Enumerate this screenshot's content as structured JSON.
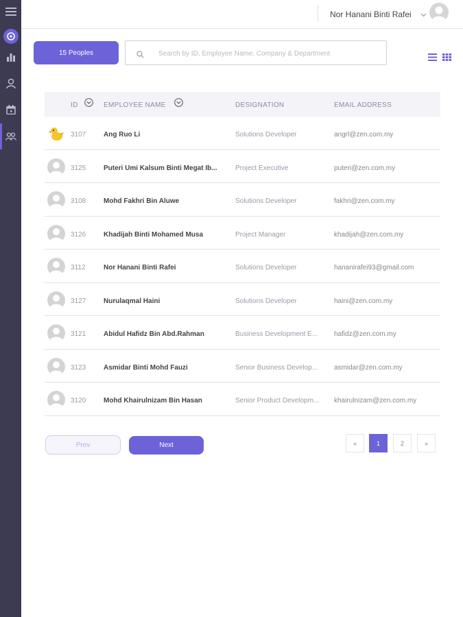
{
  "colors": {
    "accent": "#6c63d8",
    "sidebar": "#3d3b52"
  },
  "sidebar": {
    "items": [
      {
        "name": "menu",
        "icon": "hamburger-icon"
      },
      {
        "name": "logo",
        "icon": "dashboard-badge-icon"
      },
      {
        "name": "reports",
        "icon": "bar-chart-icon"
      },
      {
        "name": "profile",
        "icon": "user-icon"
      },
      {
        "name": "calendar",
        "icon": "calendar-icon"
      },
      {
        "name": "people",
        "icon": "people-icon",
        "active": true
      }
    ]
  },
  "header": {
    "user_name": "Nor Hanani Binti Rafei"
  },
  "toolbar": {
    "people_label": "15 Peoples",
    "search_placeholder": "Search by ID, Employee Name, Company & Department"
  },
  "table": {
    "columns": [
      "ID",
      "EMPLOYEE NAME",
      "DESIGNATION",
      "EMAIL ADDRESS"
    ],
    "rows": [
      {
        "id": "3107",
        "name": "Ang Ruo Li",
        "designation": "Solutions Developer",
        "email": "angrl@zen.com.my",
        "avatar": "duck"
      },
      {
        "id": "3125",
        "name": "Puteri Umi Kalsum Binti Megat Ib...",
        "designation": "Project Executive",
        "email": "puteri@zen.com.my",
        "avatar": "default"
      },
      {
        "id": "3108",
        "name": "Mohd Fakhri Bin Aluwe",
        "designation": "Solutions Developer",
        "email": "fakhri@zen.com.my",
        "avatar": "default"
      },
      {
        "id": "3126",
        "name": "Khadijah Binti Mohamed Musa",
        "designation": "Project Manager",
        "email": "khadijah@zen.com.my",
        "avatar": "default"
      },
      {
        "id": "3112",
        "name": "Nor Hanani Binti Rafei",
        "designation": "Solutions Developer",
        "email": "hananirafei93@gmail.com",
        "avatar": "default"
      },
      {
        "id": "3127",
        "name": "Nurulaqmal Haini",
        "designation": "Solutions Developer",
        "email": "haini@zen.com.my",
        "avatar": "default"
      },
      {
        "id": "3121",
        "name": "Abidul Hafidz Bin Abd.Rahman",
        "designation": "Business Development E...",
        "email": "hafidz@zen.com.my",
        "avatar": "default"
      },
      {
        "id": "3123",
        "name": "Asmidar Binti Mohd Fauzi",
        "designation": "Senior Business Develop...",
        "email": "asmidar@zen.com.my",
        "avatar": "default"
      },
      {
        "id": "3120",
        "name": "Mohd Khairulnizam Bin Hasan",
        "designation": "Senior Product Developm...",
        "email": "khairulnizam@zen.com.my",
        "avatar": "default"
      }
    ]
  },
  "pagination": {
    "prev_label": "Prev",
    "next_label": "Next",
    "first_symbol": "«",
    "last_symbol": "»",
    "pages": [
      "1",
      "2"
    ],
    "current": "1"
  }
}
